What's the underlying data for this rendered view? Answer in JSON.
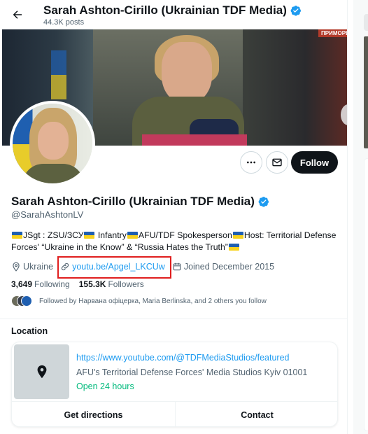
{
  "header": {
    "title": "Sarah Ashton-Cirillo (Ukrainian TDF Media)",
    "posts_count": "44.3K posts"
  },
  "banner": {
    "tag": "ПРИМОРЬЯ"
  },
  "actions": {
    "follow_label": "Follow"
  },
  "profile": {
    "name": "Sarah Ashton-Cirillo (Ukrainian TDF Media)",
    "handle": "@SarahAshtonLV",
    "bio_part1": "JSgt : ZSU/ЗСУ",
    "bio_part2": " Infantry",
    "bio_part3": "AFU/TDF Spokesperson",
    "bio_part4": "Host: Territorial Defense Forces' “Ukraine in the Know” & “Russia Hates the Truth”",
    "location": "Ukraine",
    "website": "youtu.be/Apgel_LKCUw",
    "joined": "Joined December 2015",
    "following_count": "3,649",
    "following_label": "Following",
    "followers_count": "155.3K",
    "followers_label": "Followers",
    "followed_by": "Followed by Нарвана офіцерка, Maria Berlinska, and 2 others you follow"
  },
  "location_section": {
    "heading": "Location",
    "url": "https://www.youtube.com/@TDFMediaStudios/featured",
    "address": "AFU's Territorial Defense Forces' Media Studios Kyiv  01001",
    "hours": "Open 24 hours",
    "directions_label": "Get directions",
    "contact_label": "Contact"
  },
  "colors": {
    "accent": "#1d9bf0",
    "text": "#0f1419",
    "muted": "#536471",
    "open_green": "#00ba7c",
    "highlight_box": "#e01e1e"
  },
  "icons": {
    "back": "arrow-left-icon",
    "verified": "verified-badge-icon",
    "more": "ellipsis-icon",
    "message": "envelope-icon",
    "location": "map-pin-icon",
    "link": "link-icon",
    "calendar": "calendar-icon",
    "map_pin": "map-pin-filled-icon"
  }
}
